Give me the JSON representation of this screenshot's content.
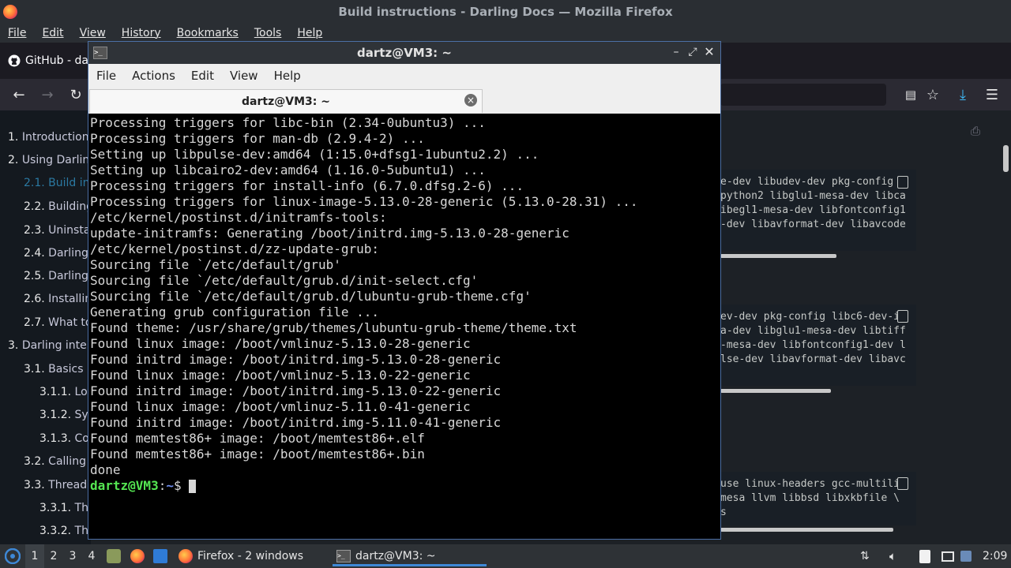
{
  "firefox": {
    "title": "Build instructions - Darling Docs — Mozilla Firefox",
    "menu": [
      "File",
      "Edit",
      "View",
      "History",
      "Bookmarks",
      "Tools",
      "Help"
    ],
    "tab_label": "GitHub - dar"
  },
  "sidebar": {
    "items": [
      {
        "num": "1.",
        "label": "Introduction"
      },
      {
        "num": "2.",
        "label": "Using Darling"
      },
      {
        "num": "2.1.",
        "label": "Build ins"
      },
      {
        "num": "2.2.",
        "label": "Building"
      },
      {
        "num": "2.3.",
        "label": "Uninstal"
      },
      {
        "num": "2.4.",
        "label": "Darling s"
      },
      {
        "num": "2.5.",
        "label": "Darling p"
      },
      {
        "num": "2.6.",
        "label": "Installing"
      },
      {
        "num": "2.7.",
        "label": "What to"
      },
      {
        "num": "3.",
        "label": "Darling intern"
      },
      {
        "num": "3.1.",
        "label": "Basics"
      },
      {
        "num": "3.1.1.",
        "label": "Loa"
      },
      {
        "num": "3.1.2.",
        "label": "Sys"
      },
      {
        "num": "3.1.3.",
        "label": "Con"
      },
      {
        "num": "3.2.",
        "label": "Calling h"
      },
      {
        "num": "3.3.",
        "label": "Threadin"
      },
      {
        "num": "3.3.1.",
        "label": "Thr"
      },
      {
        "num": "3.3.2.",
        "label": "Thr"
      }
    ]
  },
  "code_blocks": [
    {
      "lines": [
        "e-dev libudev-dev pkg-config \\",
        "python2 libglu1-mesa-dev libca",
        "ibegl1-mesa-dev libfontconfig1",
        "-dev libavformat-dev libavcode"
      ]
    },
    {
      "lines": [
        "ev-dev pkg-config libc6-dev-i3",
        "a-dev libglu1-mesa-dev libtiff",
        "-mesa-dev libfontconfig1-dev l",
        "lse-dev libavformat-dev libavc"
      ]
    },
    {
      "lines": [
        "use linux-headers gcc-multilib",
        "mesa llvm libbsd libxkbfile \\",
        "s"
      ]
    }
  ],
  "terminal": {
    "title": "dartz@VM3: ~",
    "menu": [
      "File",
      "Actions",
      "Edit",
      "View",
      "Help"
    ],
    "tab_label": "dartz@VM3: ~",
    "lines": [
      "Processing triggers for libc-bin (2.34-0ubuntu3) ...",
      "Processing triggers for man-db (2.9.4-2) ...",
      "Setting up libpulse-dev:amd64 (1:15.0+dfsg1-1ubuntu2.2) ...",
      "Setting up libcairo2-dev:amd64 (1.16.0-5ubuntu1) ...",
      "Processing triggers for install-info (6.7.0.dfsg.2-6) ...",
      "Processing triggers for linux-image-5.13.0-28-generic (5.13.0-28.31) ...",
      "/etc/kernel/postinst.d/initramfs-tools:",
      "update-initramfs: Generating /boot/initrd.img-5.13.0-28-generic",
      "/etc/kernel/postinst.d/zz-update-grub:",
      "Sourcing file `/etc/default/grub'",
      "Sourcing file `/etc/default/grub.d/init-select.cfg'",
      "Sourcing file `/etc/default/grub.d/lubuntu-grub-theme.cfg'",
      "Generating grub configuration file ...",
      "Found theme: /usr/share/grub/themes/lubuntu-grub-theme/theme.txt",
      "Found linux image: /boot/vmlinuz-5.13.0-28-generic",
      "Found initrd image: /boot/initrd.img-5.13.0-28-generic",
      "Found linux image: /boot/vmlinuz-5.13.0-22-generic",
      "Found initrd image: /boot/initrd.img-5.13.0-22-generic",
      "Found linux image: /boot/vmlinuz-5.11.0-41-generic",
      "Found initrd image: /boot/initrd.img-5.11.0-41-generic",
      "Found memtest86+ image: /boot/memtest86+.elf",
      "Found memtest86+ image: /boot/memtest86+.bin",
      "done"
    ],
    "prompt_user": "dartz@VM3",
    "prompt_sep": ":",
    "prompt_path": "~",
    "prompt_symbol": "$ "
  },
  "taskbar": {
    "workspaces": [
      "1",
      "2",
      "3",
      "4"
    ],
    "firefox_label": "Firefox - 2 windows",
    "terminal_label": "dartz@VM3: ~",
    "clock": "2:09"
  }
}
